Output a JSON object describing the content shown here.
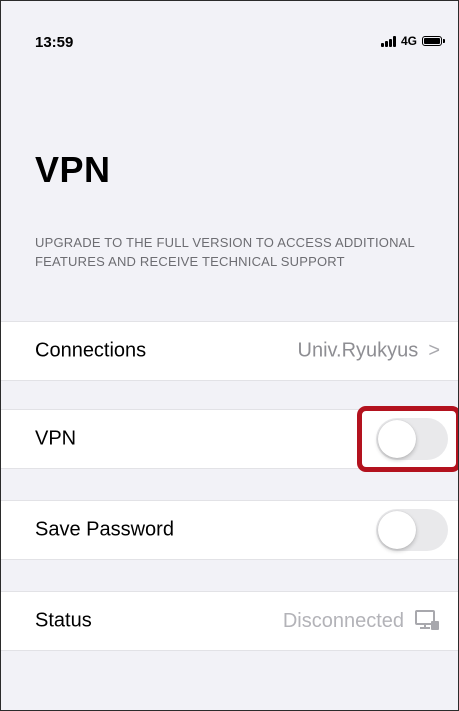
{
  "status_bar": {
    "time": "13:59",
    "network": "4G"
  },
  "page": {
    "title": "VPN",
    "upgrade_note": "UPGRADE TO THE FULL VERSION TO ACCESS ADDITIONAL FEATURES AND RECEIVE TECHNICAL SUPPORT"
  },
  "rows": {
    "connections": {
      "label": "Connections",
      "value": "Univ.Ryukyus",
      "chevron": ">"
    },
    "vpn": {
      "label": "VPN",
      "toggle_on": false
    },
    "save_password": {
      "label": "Save Password",
      "toggle_on": false
    },
    "status": {
      "label": "Status",
      "value": "Disconnected",
      "icon": "network-monitor-icon"
    }
  },
  "colors": {
    "background": "#f2f2f7",
    "row_background": "#ffffff",
    "secondary_text": "#8e8e93",
    "toggle_off": "#e9e9eb",
    "highlight": "#b3121e"
  }
}
